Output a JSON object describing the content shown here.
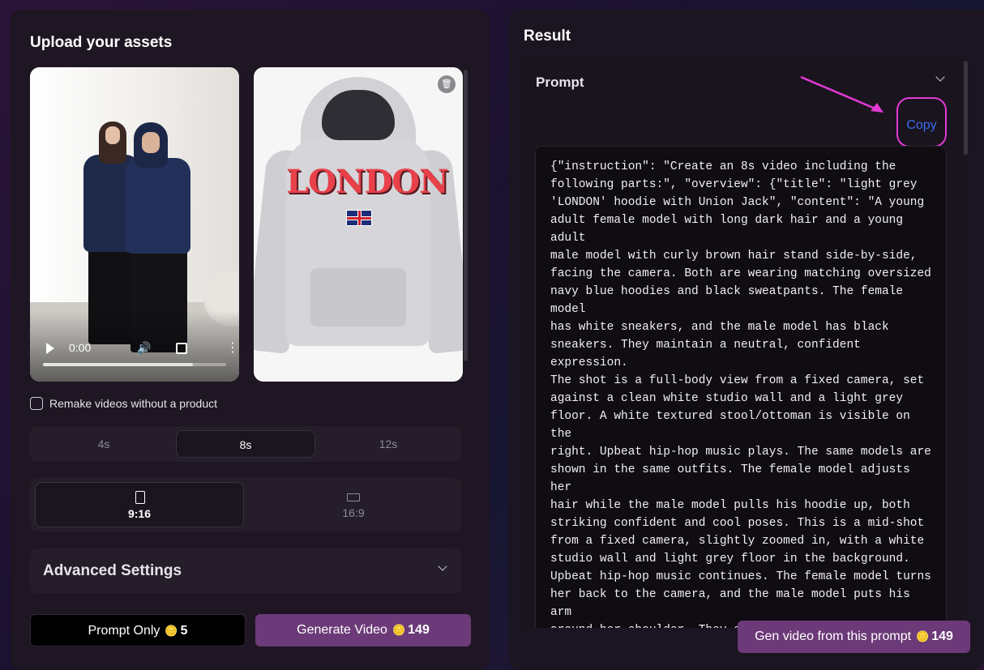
{
  "left": {
    "title": "Upload your assets",
    "video": {
      "time": "0:00",
      "progress": 0.82
    },
    "remake_checkbox": {
      "label": "Remake videos without a product",
      "checked": false
    },
    "durations": [
      {
        "label": "4s",
        "active": false
      },
      {
        "label": "8s",
        "active": true
      },
      {
        "label": "12s",
        "active": false
      }
    ],
    "ratios": [
      {
        "label": "9:16",
        "active": true,
        "icon": "portrait-icon"
      },
      {
        "label": "16:9",
        "active": false,
        "icon": "landscape-icon"
      }
    ],
    "advanced": {
      "label": "Advanced Settings"
    },
    "prompt_only_btn": {
      "label": "Prompt Only",
      "cost": "5"
    },
    "generate_btn": {
      "label": "Generate Video",
      "cost": "149"
    },
    "product_image": {
      "print": "LONDON"
    }
  },
  "right": {
    "title": "Result",
    "prompt_header": "Prompt",
    "copy_label": "Copy",
    "prompt_text": "{\"instruction\": \"Create an 8s video including the\nfollowing parts:\", \"overview\": {\"title\": \"light grey\n'LONDON' hoodie with Union Jack\", \"content\": \"A young\nadult female model with long dark hair and a young adult\nmale model with curly brown hair stand side-by-side,\nfacing the camera. Both are wearing matching oversized\nnavy blue hoodies and black sweatpants. The female model\nhas white sneakers, and the male model has black\nsneakers. They maintain a neutral, confident expression.\nThe shot is a full-body view from a fixed camera, set\nagainst a clean white studio wall and a light grey\nfloor. A white textured stool/ottoman is visible on the\nright. Upbeat hip-hop music plays. The same models are\nshown in the same outfits. The female model adjusts her\nhair while the male model pulls his hoodie up, both\nstriking confident and cool poses. This is a mid-shot\nfrom a fixed camera, slightly zoomed in, with a white\nstudio wall and light grey floor in the background.\nUpbeat hip-hop music continues. The female model turns\nher back to the camera, and the male model puts his arm\naround her shoulder. They appear relaxed and playful.\nThe shot is a full-body view from a fixed camera,\nagainst the white studio wall, light grey floor, and the\nwhite textured stool/ottoman on the right. Upbeat hip-\nhop music continues. The female model turns back to face",
    "gen_btn": {
      "label": "Gen video from this prompt",
      "cost": "149"
    }
  },
  "colors": {
    "accent": "#6c3a78",
    "link": "#3b6cf0",
    "highlight": "#e23ad4"
  },
  "icons": [
    "play-icon",
    "volume-icon",
    "fullscreen-icon",
    "more-icon",
    "trash-icon",
    "chevron-down-icon",
    "coins-icon"
  ]
}
